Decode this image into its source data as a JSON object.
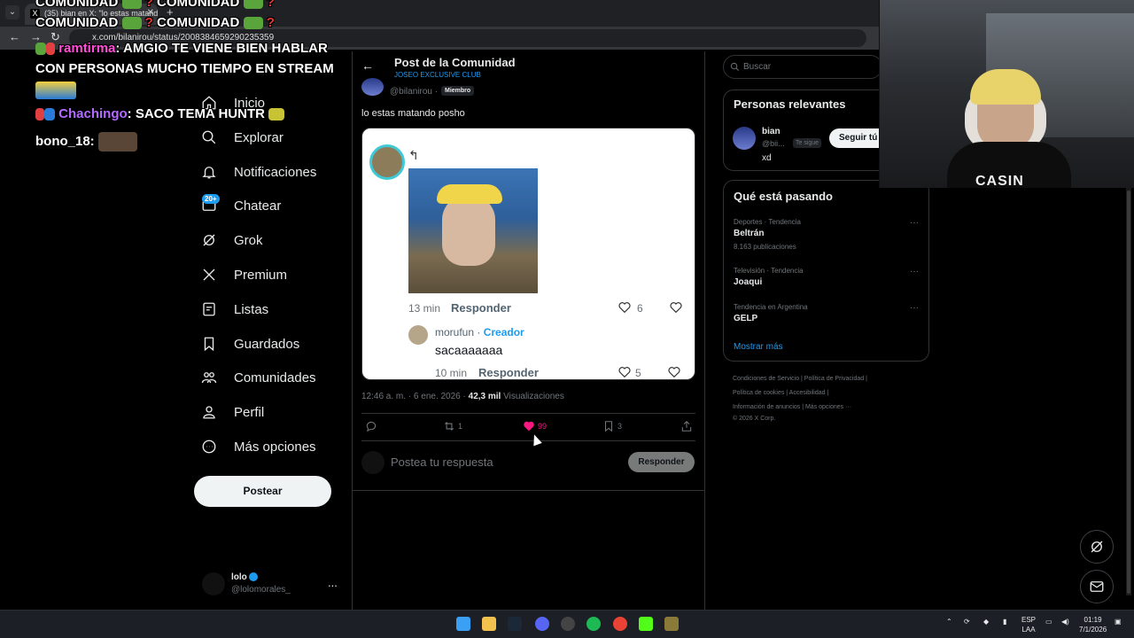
{
  "browser": {
    "tab_title": "(35) bian en X: \"lo estas matand",
    "tab_favicon": "X",
    "url": "x.com/bilanirou/status/2008384659290235359"
  },
  "overlay_chat": {
    "line1": "COMUNIDAD",
    "line1b": "COMUNIDAD",
    "line2": "COMUNIDAD",
    "line2b": "COMUNIDAD",
    "qmark": "?",
    "msg1_user": "ramtirma",
    "msg1_text": ": AMGIO TE VIENE BIEN HABLAR",
    "msg1_text2": "CON PERSONAS MUCHO TIEMPO EN STREAM",
    "msg2_user": "Chachingo",
    "msg2_text": ": SACO TEMA HUNTR",
    "msg3_user": "bono_18:"
  },
  "nav": {
    "items": [
      {
        "label": "Inicio",
        "icon": "home-icon"
      },
      {
        "label": "Explorar",
        "icon": "search-icon"
      },
      {
        "label": "Notificaciones",
        "icon": "bell-icon"
      },
      {
        "label": "Chatear",
        "icon": "chat-icon",
        "badge": "20+"
      },
      {
        "label": "Grok",
        "icon": "grok-icon"
      },
      {
        "label": "Premium",
        "icon": "x-logo-icon"
      },
      {
        "label": "Listas",
        "icon": "list-icon"
      },
      {
        "label": "Guardados",
        "icon": "bookmark-icon"
      },
      {
        "label": "Comunidades",
        "icon": "communities-icon"
      },
      {
        "label": "Perfil",
        "icon": "person-icon"
      },
      {
        "label": "Más opciones",
        "icon": "more-circle-icon"
      }
    ],
    "post_button": "Postear",
    "account": {
      "name": "lolo",
      "handle": "@lolomorales_",
      "menu": "..."
    }
  },
  "post": {
    "back": "←",
    "header_title": "Post de la Comunidad",
    "header_subtitle": "JOSEO EXCLUSIVE CLUB",
    "author_handle": "@bilanirou ·",
    "member_label": "Miembro",
    "text": "lo estas matando posho",
    "screenshot": {
      "arrow": "↰",
      "comment1_time": "13 min",
      "comment1_reply": "Responder",
      "comment1_likes": "6",
      "comment2_user": "morufun",
      "comment2_sep": " · ",
      "comment2_role": "Creador",
      "comment2_text": "sacaaaaaaa",
      "comment2_time": "10 min",
      "comment2_reply": "Responder",
      "comment2_likes": "5"
    },
    "timestamp": "12:46 a. m. · 6 ene. 2026 · ",
    "views_count": "42,3 mil",
    "views_label": " Visualizaciones",
    "actions": {
      "replies": "",
      "reposts": "1",
      "likes": "99",
      "bookmarks": "3"
    },
    "reply_placeholder": "Postea tu respuesta",
    "reply_button": "Responder"
  },
  "sidebar": {
    "search_placeholder": "Buscar",
    "relevant_title": "Personas relevantes",
    "relevant_user": {
      "name": "bian",
      "handle": "@bii...",
      "follows_you": "Te sigue",
      "follow_button": "Seguir tú",
      "bio": "xd"
    },
    "trends_title": "Qué está pasando",
    "trends": [
      {
        "meta": "Deportes · Tendencia",
        "name": "Beltrán",
        "count": "8.163 publicaciones"
      },
      {
        "meta": "Televisión · Tendencia",
        "name": "Joaqui",
        "count": ""
      },
      {
        "meta": "Tendencia en Argentina",
        "name": "GELP",
        "count": ""
      }
    ],
    "trend_menu": "···",
    "show_more": "Mostrar más",
    "footer_line1": "Condiciones de Servicio  |  Política de Privacidad  |",
    "footer_line2": "Política de cookies  |  Accesibilidad  |",
    "footer_line3": "Información de anuncios  |  Más opciones ···",
    "footer_line4": "© 2026 X Corp."
  },
  "webcam": {
    "shirt_text": "CASIN"
  },
  "taskbar": {
    "lang": "ESP",
    "lang2": "LAA",
    "time": "01:19",
    "date": "7/1/2026"
  },
  "colors": {
    "accent": "#1d9bf0",
    "like": "#f91880",
    "background": "#000000"
  }
}
